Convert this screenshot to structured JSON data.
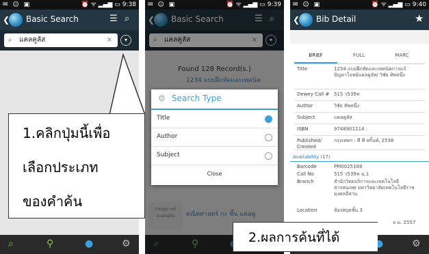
{
  "status": {
    "screen1_time": "9:38",
    "screen2_time": "9:39",
    "screen3_time": "9:40"
  },
  "screen1": {
    "title": "Basic Search",
    "search_value": "แคลคูลัส",
    "callout_lines": [
      "1.คลิกปุ่มนี้เพื่อ",
      "เลือกประเภท",
      "ของคำค้น"
    ]
  },
  "screen2": {
    "title": "Basic Search",
    "search_value": "แคลคูลัส",
    "found_text": "Found 128 Record(s.)",
    "bg_item_1": "1234 แบบฝึกหัดและเทคนิค",
    "bg_item_2": "คณิตศาสตร์ กะ ชิ้น แคลคู",
    "bg_image_label": "image not available",
    "dialog": {
      "title": "Search Type",
      "options": [
        "Title",
        "Author",
        "Subject"
      ],
      "selected": "Title",
      "close_label": "Close"
    }
  },
  "screen3": {
    "title": "Bib Detail",
    "tabs": [
      "BRIEF",
      "FULL",
      "MARC"
    ],
    "rows": [
      {
        "k": "Title",
        "v": "1234 แบบฝึกหัดและเทคนิคการแก้ปัญหาโจทย์แคลคูลัส/ วิชัย ทัพหนึ่ง"
      },
      {
        "k": "Dewey Call #",
        "v": "515 ว539ห"
      },
      {
        "k": "Author",
        "v": "วิชัย ทัพหนึ่ง"
      },
      {
        "k": "Subject",
        "v": "แคลคูลัส"
      },
      {
        "k": "ISBN",
        "v": "9748901114 :"
      },
      {
        "k": "Published/ Created",
        "v": "กรุงเทพฯ : ที พี พริ้นท์, 2538"
      }
    ],
    "availability_label": "Availability (17)",
    "avail_rows": [
      {
        "k": "Barcode",
        "v": "PM0025188"
      },
      {
        "k": "Call No",
        "v": "515 ว539ห ฉ.1"
      },
      {
        "k": "Branch",
        "v": "สำนักวิทยบริการและเทคโนโลยีสารสนเทศ มหาวิทยาลัยเทคโนโลยีราชมงคลอีสาน"
      },
      {
        "k": "Location",
        "v": "ห้องสมุดชั้น 3"
      }
    ],
    "due_fragment": "ล ม. 2557",
    "callout_text": "2.ผลการค้นที่ได้"
  }
}
